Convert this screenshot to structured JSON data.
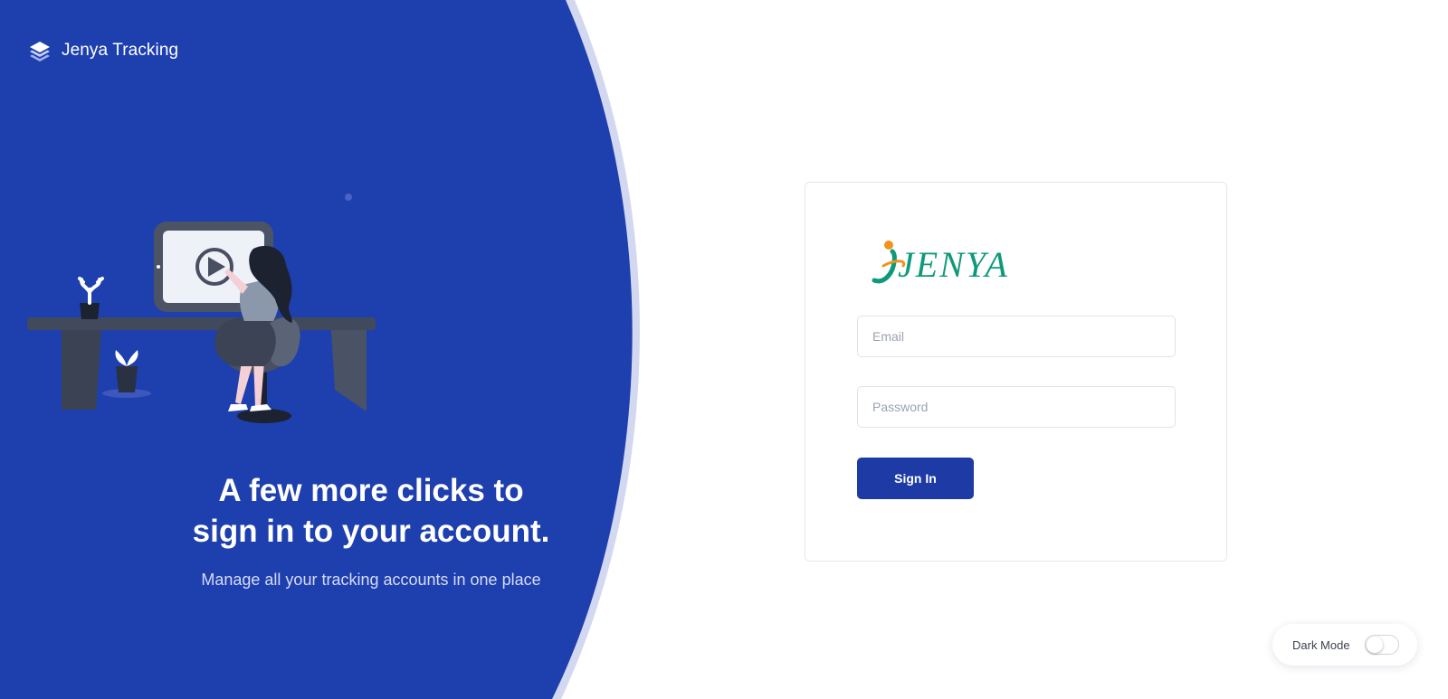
{
  "brand": {
    "name": "Jenya Tracking",
    "icon": "layers-icon"
  },
  "hero": {
    "title_line1": "A few more clicks to",
    "title_line2": "sign in to your account.",
    "subtitle": "Manage all your tracking accounts in one place"
  },
  "login": {
    "logo_text": "JENYA",
    "email_placeholder": "Email",
    "password_placeholder": "Password",
    "submit_label": "Sign In"
  },
  "settings": {
    "dark_mode_label": "Dark Mode",
    "dark_mode_on": false
  },
  "colors": {
    "primary": "#1e3fae",
    "accent_light": "#d3d8f1",
    "button": "#1d3aa5",
    "logo_green": "#0e9a7a",
    "logo_orange": "#f0931e"
  }
}
